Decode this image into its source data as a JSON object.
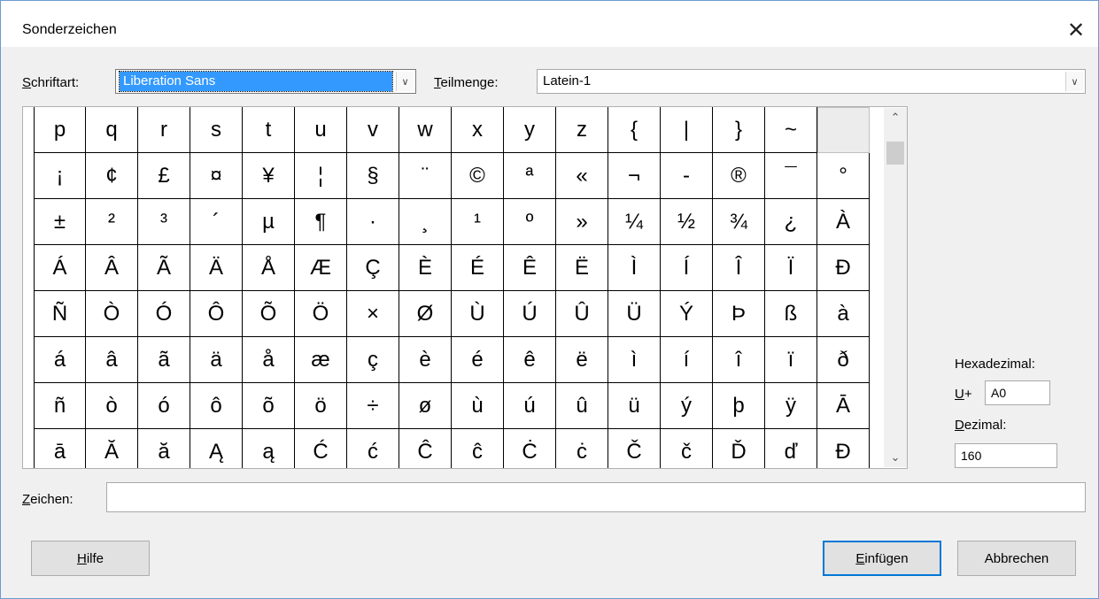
{
  "dialog": {
    "title": "Sonderzeichen",
    "close_glyph": "✕"
  },
  "font": {
    "label_first": "S",
    "label_rest": "chriftart:",
    "value": "Liberation Sans"
  },
  "subset": {
    "label_first": "T",
    "label_rest": "eilmenge:",
    "value": "Latein-1"
  },
  "characters": {
    "rows": [
      [
        "p",
        "q",
        "r",
        "s",
        "t",
        "u",
        "v",
        "w",
        "x",
        "y",
        "z",
        "{",
        "|",
        "}",
        "~",
        " "
      ],
      [
        "¡",
        "¢",
        "£",
        "¤",
        "¥",
        "¦",
        "§",
        "¨",
        "©",
        "ª",
        "«",
        "¬",
        "-",
        "®",
        "¯",
        "°"
      ],
      [
        "±",
        "²",
        "³",
        "´",
        "µ",
        "¶",
        "·",
        "¸",
        "¹",
        "º",
        "»",
        "¼",
        "½",
        "¾",
        "¿",
        "À"
      ],
      [
        "Á",
        "Â",
        "Ã",
        "Ä",
        "Å",
        "Æ",
        "Ç",
        "È",
        "É",
        "Ê",
        "Ë",
        "Ì",
        "Í",
        "Î",
        "Ï",
        "Ð"
      ],
      [
        "Ñ",
        "Ò",
        "Ó",
        "Ô",
        "Õ",
        "Ö",
        "×",
        "Ø",
        "Ù",
        "Ú",
        "Û",
        "Ü",
        "Ý",
        "Þ",
        "ß",
        "à"
      ],
      [
        "á",
        "â",
        "ã",
        "ä",
        "å",
        "æ",
        "ç",
        "è",
        "é",
        "ê",
        "ë",
        "ì",
        "í",
        "î",
        "ï",
        "ð"
      ],
      [
        "ñ",
        "ò",
        "ó",
        "ô",
        "õ",
        "ö",
        "÷",
        "ø",
        "ù",
        "ú",
        "û",
        "ü",
        "ý",
        "þ",
        "ÿ",
        "Ā"
      ],
      [
        "ā",
        "Ă",
        "ă",
        "Ą",
        "ą",
        "Ć",
        "ć",
        "Ĉ",
        "ĉ",
        "Ċ",
        "ċ",
        "Č",
        "č",
        "Ď",
        "ď",
        "Đ"
      ]
    ],
    "selected": [
      0,
      15
    ]
  },
  "scrollbar": {
    "up_glyph": "⌃",
    "down_glyph": "⌄"
  },
  "hex": {
    "label": "Hexadezimal:",
    "prefix_first": "U",
    "prefix_rest": "+",
    "value": "A0"
  },
  "decimal": {
    "label_first": "D",
    "label_rest": "ezimal:",
    "value": "160"
  },
  "zeichen": {
    "label_first": "Z",
    "label_rest": "eichen:",
    "value": ""
  },
  "buttons": {
    "help_first": "H",
    "help_rest": "ilfe",
    "insert_first": "E",
    "insert_rest": "infügen",
    "cancel": "Abbrechen"
  }
}
